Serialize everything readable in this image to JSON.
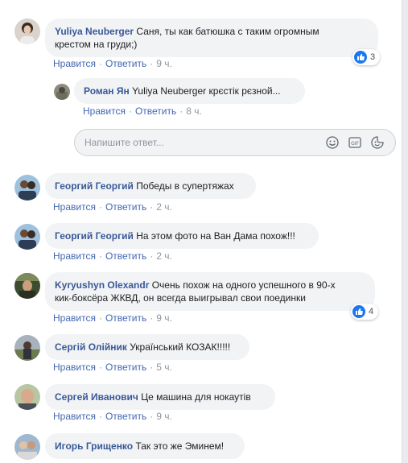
{
  "actions": {
    "like": "Нравится",
    "reply": "Ответить",
    "sep": "·"
  },
  "reply_placeholder": "Напишите ответ...",
  "comments": [
    {
      "author": "Yuliya Neuberger",
      "text_line1": "Саня, ты как батюшка с таким огромным",
      "text_line2": "крестом на груди;)",
      "time": "9 ч.",
      "reactions": "3"
    },
    {
      "author": "Роман Ян",
      "text": "Yuliya Neuberger крєстік рєзной...",
      "time": "8 ч."
    },
    {
      "author": "Георгий Георгий",
      "text": "Победы в супертяжах",
      "time": "2 ч."
    },
    {
      "author": "Георгий Георгий",
      "text": "На этом фото на Ван Дама похож!!!",
      "time": "2 ч."
    },
    {
      "author": "Kyryushyn Olexandr",
      "text_line1": "Очень похож на одного успешного в 90-х",
      "text_line2": "кик-боксёра ЖКВД, он всегда выигрывал свои поединки",
      "time": "9 ч.",
      "reactions": "4"
    },
    {
      "author": "Сергій Олійник",
      "text": "Український КОЗАК!!!!!",
      "time": "5 ч."
    },
    {
      "author": "Сергей Иванович",
      "text": "Це машина для нокаутів",
      "time": "9 ч."
    },
    {
      "author": "Игорь Грищенко",
      "text": "Так это же Эминем!"
    }
  ],
  "colors": {
    "link": "#385898",
    "action": "#4267b2",
    "bubble": "#f2f3f5",
    "like": "#1877f2"
  }
}
